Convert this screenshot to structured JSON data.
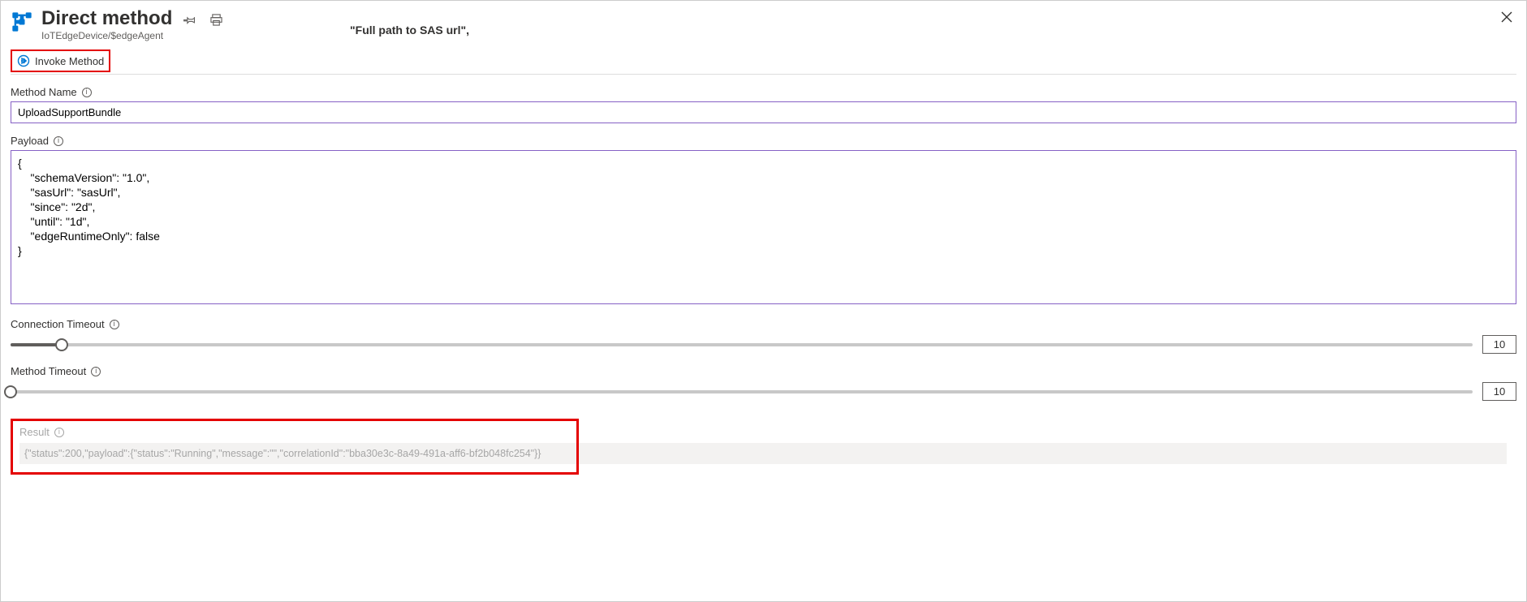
{
  "header": {
    "title": "Direct method",
    "breadcrumb": "IoTEdgeDevice/$edgeAgent",
    "path_hint": "\"Full path to SAS url\","
  },
  "toolbar": {
    "invoke_label": "Invoke Method"
  },
  "fields": {
    "method_name_label": "Method Name",
    "method_name_value": "UploadSupportBundle",
    "payload_label": "Payload",
    "payload_value": "{\n    \"schemaVersion\": \"1.0\",\n    \"sasUrl\": \"sasUrl\",\n    \"since\": \"2d\",\n    \"until\": \"1d\",\n    \"edgeRuntimeOnly\": false\n}",
    "connection_timeout_label": "Connection Timeout",
    "connection_timeout_value": "10",
    "method_timeout_label": "Method Timeout",
    "method_timeout_value": "10",
    "result_label": "Result",
    "result_value": "{\"status\":200,\"payload\":{\"status\":\"Running\",\"message\":\"\",\"correlationId\":\"bba30e3c-8a49-491a-aff6-bf2b048fc254\"}}"
  },
  "sliders": {
    "connection_fill_pct": 3.5,
    "method_fill_pct": 0
  }
}
